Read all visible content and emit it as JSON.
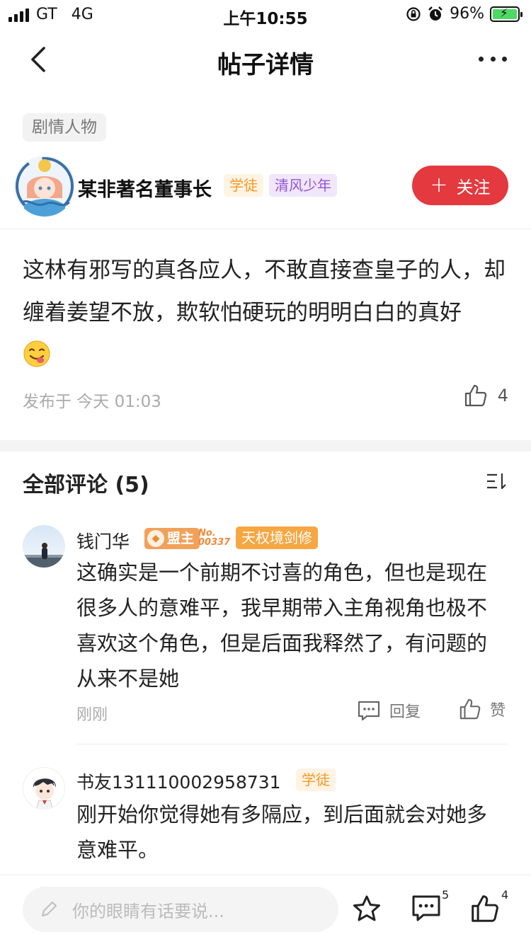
{
  "status_bar": {
    "carrier": "GT",
    "network": "4G",
    "time": "上午10:55",
    "battery": "96%"
  },
  "nav": {
    "title": "帖子详情"
  },
  "post": {
    "category": "剧情人物",
    "author": {
      "name": "某非著名董事长",
      "badges": [
        "学徒",
        "清风少年"
      ]
    },
    "follow_label": "关注",
    "content": "这林有邪写的真各应人，不敢直接查皇子的人，却缠着姜望不放，欺软怕硬玩的明明白白的真好",
    "published": "发布于 今天 01:03",
    "like_count": "4"
  },
  "comments_section": {
    "title": "全部评论 (5)",
    "items": [
      {
        "name": "钱门华",
        "league_badge": "盟主",
        "league_no": "No.",
        "league_number": "00337",
        "realm_badge": "天权境剑修",
        "text": "这确实是一个前期不讨喜的角色，但也是现在很多人的意难平，我早期带入主角视角也极不喜欢这个角色，但是后面我释然了，有问题的从来不是她",
        "time": "刚刚",
        "reply_label": "回复",
        "like_label": "赞"
      },
      {
        "name": "书友131110002958731",
        "badge": "学徒",
        "text": "刚开始你觉得她有多隔应，到后面就会对她多意难平。"
      }
    ]
  },
  "bottom_bar": {
    "input_placeholder": "你的眼睛有话要说...",
    "comment_count": "5",
    "like_count": "4"
  },
  "colors": {
    "accent_red": "#e3393f",
    "badge_orange": "#f59a23",
    "badge_purple": "#9553d6"
  }
}
